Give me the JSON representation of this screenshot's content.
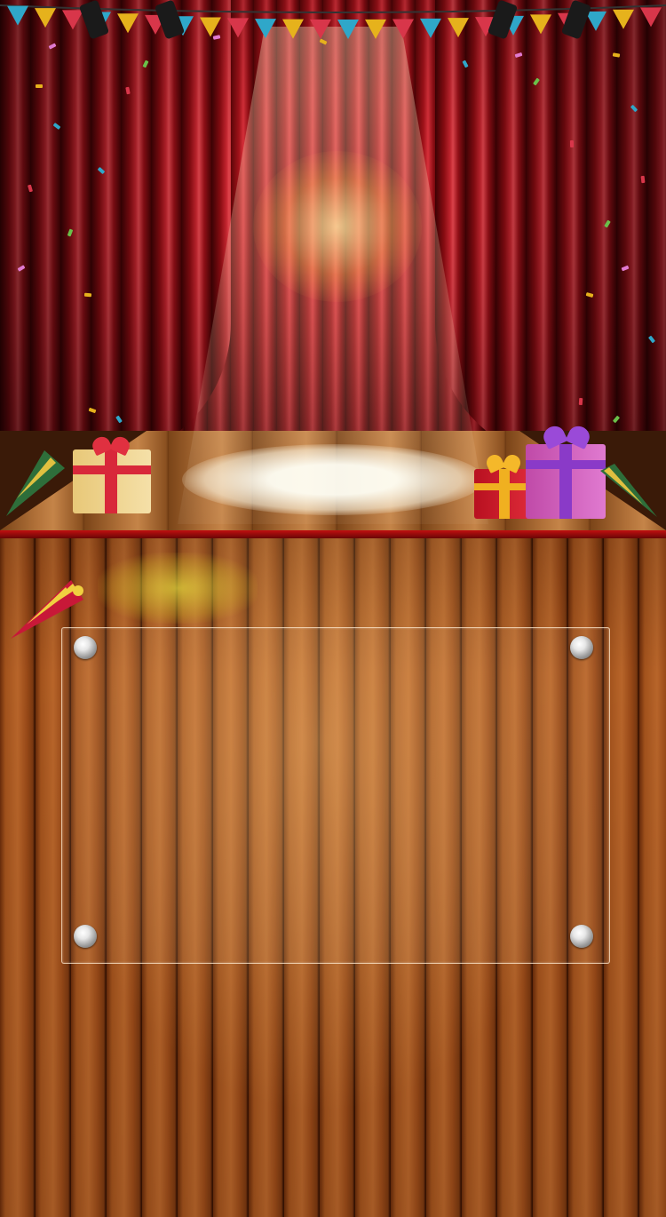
{
  "scene": {
    "stage": {
      "curtain_color": "#b01520",
      "floor_color": "#b07038",
      "spotlight_color": "#fff8e6"
    },
    "board": {
      "wood_color": "#a2521c",
      "glass_border_color": "#f0dcc8"
    },
    "decorations": {
      "bunting_colors": [
        "#2fa7c9",
        "#e6b21c",
        "#d8364a",
        "#2fa7c9",
        "#e6b21c",
        "#d8364a"
      ],
      "gift_icons": [
        "gift-box-icon",
        "gift-box-icon",
        "gift-box-icon"
      ],
      "horn_icons": [
        "party-horn-icon",
        "party-horn-icon",
        "party-horn-icon"
      ]
    }
  }
}
